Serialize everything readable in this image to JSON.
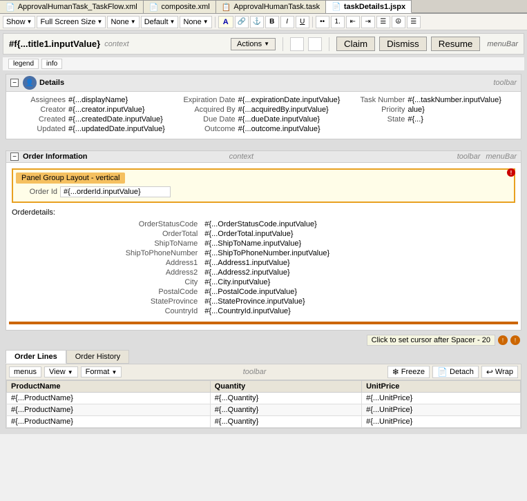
{
  "tabs": [
    {
      "label": "ApprovalHumanTask_TaskFlow.xml",
      "icon": "xml-icon",
      "active": false
    },
    {
      "label": "composite.xml",
      "icon": "xml-icon",
      "active": false
    },
    {
      "label": "ApprovalHumanTask.task",
      "icon": "task-icon",
      "active": false
    },
    {
      "label": "taskDetails1.jspx",
      "icon": "jspx-icon",
      "active": true
    }
  ],
  "toolbar2": {
    "show_label": "Show",
    "fullscreen_label": "Full Screen Size",
    "none_label": "None",
    "default_label": "Default",
    "none2_label": "None"
  },
  "header": {
    "title": "#f{...title1.inputValue}",
    "context_label": "context",
    "actions_label": "Actions",
    "claim_label": "Claim",
    "dismiss_label": "Dismiss",
    "resume_label": "Resume",
    "menubar_label": "menuBar"
  },
  "legend_info": {
    "legend_label": "legend",
    "info_label": "info"
  },
  "details": {
    "title": "Details",
    "toolbar_label": "toolbar",
    "fields": {
      "assignees_label": "Assignees",
      "assignees_value": "#{...displayName}",
      "creator_label": "Creator",
      "creator_value": "#{...creator.inputValue}",
      "created_label": "Created",
      "created_value": "#{...createdDate.inputValue}",
      "updated_label": "Updated",
      "updated_value": "#{...updatedDate.inputValue}",
      "expiration_date_label": "Expiration Date",
      "expiration_date_value": "#{...expirationDate.inputValue}",
      "acquired_by_label": "Acquired By",
      "acquired_by_value": "#{...acquiredBy.inputValue}",
      "due_date_label": "Due Date",
      "due_date_value": "#{...dueDate.inputValue}",
      "outcome_label": "Outcome",
      "outcome_value": "#{...outcome.inputValue}",
      "task_number_label": "Task Number",
      "task_number_value": "#{...taskNumber.inputValue}",
      "priority_label": "Priority",
      "priority_value": "alue}",
      "state_label": "State",
      "state_value": "#{...}"
    }
  },
  "order_info": {
    "title": "Order Information",
    "context_label": "context",
    "toolbar_label": "toolbar",
    "menubar_label": "menuBar",
    "panel_group_label": "Panel Group Layout - vertical",
    "order_id_label": "Order Id",
    "order_id_value": "#{...orderId.inputValue}",
    "order_details_label": "Orderdetails:",
    "rows": [
      {
        "label": "OrderStatusCode",
        "value": "#{...OrderStatusCode.inputValue}"
      },
      {
        "label": "OrderTotal",
        "value": "#{...OrderTotal.inputValue}"
      },
      {
        "label": "ShipToName",
        "value": "#{...ShipToName.inputValue}"
      },
      {
        "label": "ShipToPhoneNumber",
        "value": "#{...ShipToPhoneNumber.inputValue}"
      },
      {
        "label": "Address1",
        "value": "#{...Address1.inputValue}"
      },
      {
        "label": "Address2",
        "value": "#{...Address2.inputValue}"
      },
      {
        "label": "City",
        "value": "#{...City.inputValue}"
      },
      {
        "label": "PostalCode",
        "value": "#{...PostalCode.inputValue}"
      },
      {
        "label": "StateProvince",
        "value": "#{...StateProvince.inputValue}"
      },
      {
        "label": "CountryId",
        "value": "#{...CountryId.inputValue}"
      }
    ]
  },
  "cursor_bar": {
    "text": "Click to set cursor after Spacer - 20"
  },
  "order_lines": {
    "tab1_label": "Order Lines",
    "tab2_label": "Order History",
    "toolbar": {
      "menus_label": "menus",
      "view_label": "View",
      "format_label": "Format",
      "toolbar_label": "toolbar",
      "freeze_label": "Freeze",
      "detach_label": "Detach",
      "wrap_label": "Wrap"
    },
    "columns": [
      "ProductName",
      "Quantity",
      "UnitPrice"
    ],
    "rows": [
      [
        "#{...ProductName}",
        "#{...Quantity}",
        "#{...UnitPrice}"
      ],
      [
        "#{...ProductName}",
        "#{...Quantity}",
        "#{...UnitPrice}"
      ],
      [
        "#{...ProductName}",
        "#{...Quantity}",
        "#{...UnitPrice}"
      ]
    ]
  }
}
